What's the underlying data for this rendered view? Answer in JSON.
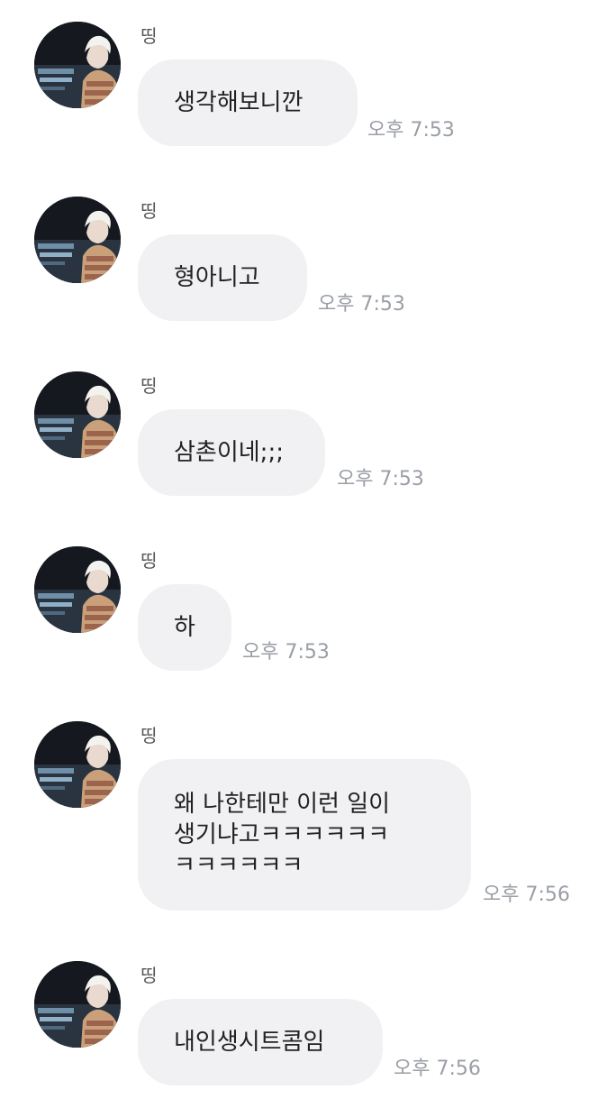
{
  "chat": {
    "messages": [
      {
        "sender": "띵",
        "text": "생각해보니깐",
        "time": "오후 7:53"
      },
      {
        "sender": "띵",
        "text": "형아니고",
        "time": "오후 7:53"
      },
      {
        "sender": "띵",
        "text": "삼촌이네;;;",
        "time": "오후 7:53"
      },
      {
        "sender": "띵",
        "text": "하",
        "time": "오후 7:53"
      },
      {
        "sender": "띵",
        "text": "왜 나한테만 이런 일이\n생기냐고ㅋㅋㅋㅋㅋㅋ\nㅋㅋㅋㅋㅋㅋ",
        "time": "오후 7:56"
      },
      {
        "sender": "띵",
        "text": "내인생시트콤임",
        "time": "오후 7:56"
      }
    ]
  },
  "colors": {
    "bubble": "#f1f1f3",
    "text": "#222222",
    "time": "#9a9ea6",
    "sender": "#555555"
  },
  "icons": {
    "avatar": "profile-photo-avatar"
  }
}
